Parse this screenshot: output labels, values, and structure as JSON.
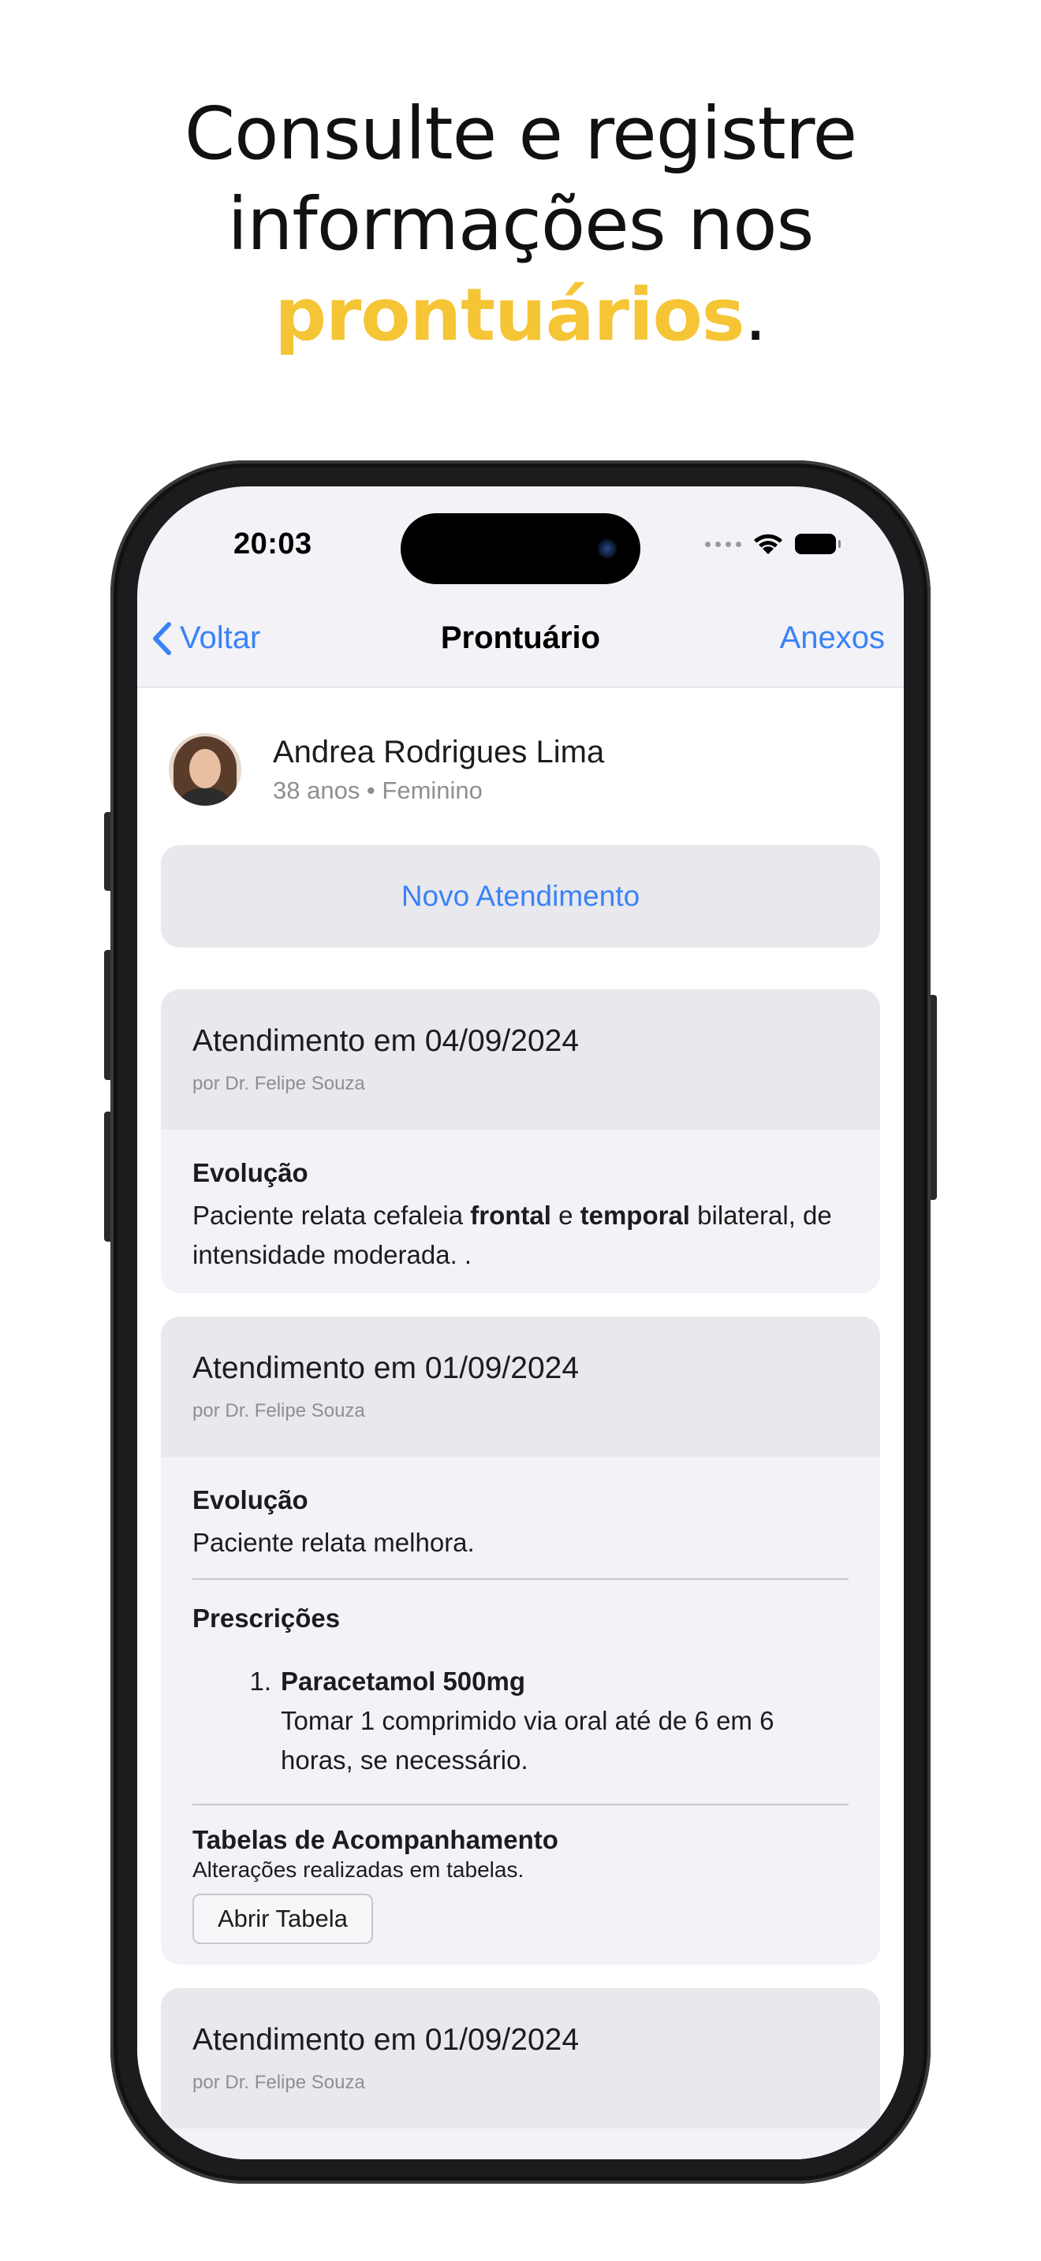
{
  "headline": {
    "line1": "Consulte e registre",
    "line2": "informações nos",
    "highlight": "prontuários",
    "end": ".",
    "highlight_color": "#F5C536"
  },
  "status": {
    "time": "20:03",
    "icons": [
      "cellular-dots-icon",
      "wifi-icon",
      "battery-icon"
    ]
  },
  "nav": {
    "back": "Voltar",
    "title": "Prontuário",
    "right": "Anexos",
    "accent": "#3A82F7"
  },
  "patient": {
    "name": "Andrea Rodrigues Lima",
    "meta": "38 anos • Feminino"
  },
  "new_button": "Novo Atendimento",
  "records": [
    {
      "title": "Atendimento em 04/09/2024",
      "author": "por Dr. Felipe Souza",
      "evolucao_label": "Evolução",
      "evolucao": {
        "t1": "Paciente relata cefaleia ",
        "b1": "frontal",
        "t2": " e ",
        "b2": "temporal",
        "t3": " bilateral, de intensidade moderada. ."
      }
    },
    {
      "title": "Atendimento em 01/09/2024",
      "author": "por Dr. Felipe Souza",
      "evolucao_label": "Evolução",
      "evolucao_text": "Paciente relata melhora.",
      "prescricoes_label": "Prescrições",
      "prescricoes": [
        {
          "num": "1.",
          "name": "Paracetamol 500mg",
          "instructions": "Tomar 1 comprimido via oral até de 6 em 6 horas, se necessário."
        }
      ],
      "tabelas_label": "Tabelas de Acompanhamento",
      "tabelas_desc": "Alterações realizadas em tabelas.",
      "tabelas_button": "Abrir Tabela"
    },
    {
      "title": "Atendimento em 01/09/2024",
      "author": "por Dr. Felipe Souza"
    }
  ]
}
